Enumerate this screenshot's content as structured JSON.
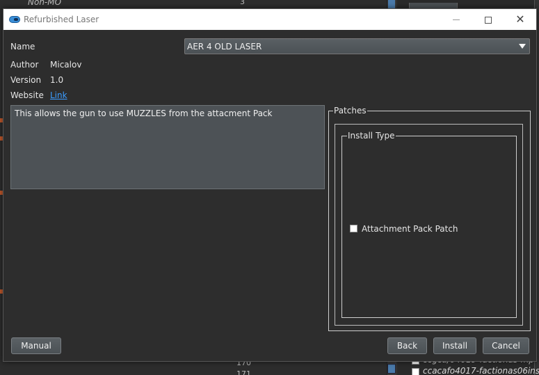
{
  "background": {
    "top_row_text": "Non-MO",
    "top_row_count": "3",
    "bottom_num_1": "170",
    "bottom_num_2": "171",
    "right_list": [
      "ccgcu/04019-factionas-mp",
      "ccacafo4017-factionas06inst"
    ]
  },
  "dialog": {
    "title": "Refurbished Laser",
    "fields": {
      "name_label": "Name",
      "name_value": "AER 4 OLD LASER",
      "author_label": "Author",
      "author_value": "Micalov",
      "version_label": "Version",
      "version_value": "1.0",
      "website_label": "Website",
      "website_value": "Link"
    },
    "description": "This allows the gun to use MUZZLES from the attacment Pack",
    "patches": {
      "group_title": "Patches",
      "install_type_title": "Install Type",
      "options": [
        {
          "label": "Attachment Pack Patch",
          "checked": false
        }
      ]
    },
    "buttons": {
      "manual": "Manual",
      "back": "Back",
      "install": "Install",
      "cancel": "Cancel"
    }
  },
  "colors": {
    "accent": "#3a8fd8",
    "link": "#3b9cff",
    "dialog_bg": "#2d2d2d"
  }
}
